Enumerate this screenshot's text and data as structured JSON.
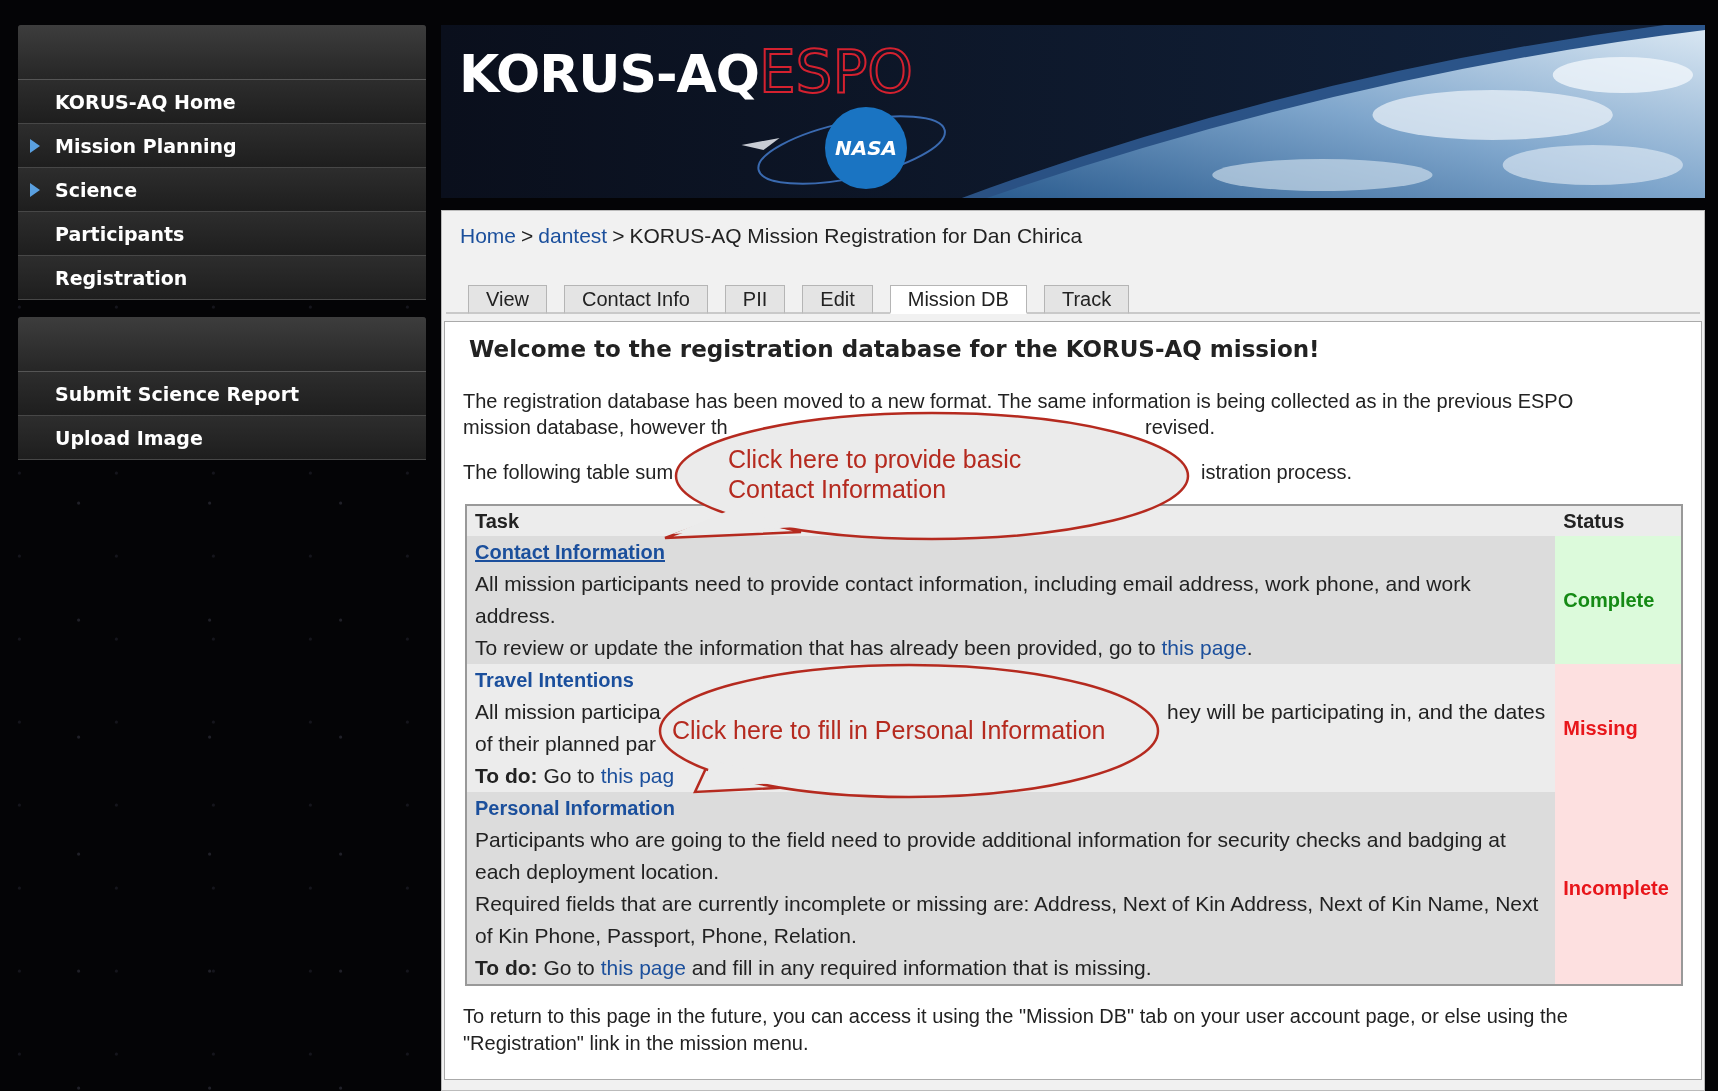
{
  "sidebar": {
    "menus": [
      {
        "items": [
          {
            "label": "KORUS-AQ Home",
            "expandable": false
          },
          {
            "label": "Mission Planning",
            "expandable": true
          },
          {
            "label": "Science",
            "expandable": true
          },
          {
            "label": "Participants",
            "expandable": false
          },
          {
            "label": "Registration",
            "expandable": false
          }
        ]
      },
      {
        "items": [
          {
            "label": "Submit Science Report",
            "expandable": false
          },
          {
            "label": "Upload Image",
            "expandable": false
          }
        ]
      }
    ]
  },
  "banner": {
    "title": "KORUS-AQ",
    "brand": "ESPO",
    "logo_text": "NASA"
  },
  "breadcrumb": [
    {
      "label": "Home",
      "kind": "link"
    },
    {
      "label": ">",
      "kind": "separator"
    },
    {
      "label": "dantest",
      "kind": "link"
    },
    {
      "label": ">",
      "kind": "separator"
    },
    {
      "label": "KORUS-AQ Mission Registration for Dan Chirica",
      "kind": "current"
    }
  ],
  "tabs": [
    {
      "label": "View",
      "selected": false
    },
    {
      "label": "Contact Info",
      "selected": false
    },
    {
      "label": "PII",
      "selected": false
    },
    {
      "label": "Edit",
      "selected": false
    },
    {
      "label": "Mission DB",
      "selected": true
    },
    {
      "label": "Track",
      "selected": false
    }
  ],
  "heading": "Welcome to the registration database for the KORUS-AQ mission!",
  "intro": [
    {
      "lines": [
        {
          "text": "The registration database has been moved to a new format. The same information is being collected as in the previous ESPO"
        },
        {
          "text": "mission database, however th",
          "after": "revised."
        }
      ]
    },
    {
      "lines": [
        {
          "text": "The following table sum",
          "after": "istration process."
        }
      ]
    }
  ],
  "table": {
    "columns": [
      "Task",
      "Status"
    ],
    "rows": [
      {
        "task": "Contact Information",
        "underlined": true,
        "paragraphs": [
          {
            "parts": [
              {
                "kind": "text",
                "text": "All mission participants need to provide contact information, including email address, work phone, and work address."
              }
            ]
          },
          {
            "parts": [
              {
                "kind": "text",
                "text": "To review or update the information that has already been provided, go to "
              },
              {
                "kind": "link",
                "text": "this page"
              },
              {
                "kind": "text",
                "text": "."
              }
            ]
          }
        ],
        "status": {
          "label": "Complete",
          "kind": "complete"
        }
      },
      {
        "task": "Travel Intentions",
        "underlined": false,
        "paragraphs": [
          {
            "parts": [
              {
                "kind": "text",
                "text": "All mission participa"
              }
            ],
            "after": "hey will be participating in, and the dates"
          },
          {
            "parts": [
              {
                "kind": "text",
                "text": "of their planned par"
              }
            ]
          },
          {
            "parts": [
              {
                "kind": "bold",
                "text": "To do:"
              },
              {
                "kind": "text",
                "text": " Go to "
              },
              {
                "kind": "link",
                "text": "this pag"
              }
            ]
          }
        ],
        "status": {
          "label": "Missing",
          "kind": "missing"
        }
      },
      {
        "task": "Personal Information",
        "underlined": false,
        "paragraphs": [
          {
            "parts": [
              {
                "kind": "text",
                "text": "Participants who are going to the field need to provide additional information for security checks and badging at each deployment location."
              }
            ]
          },
          {
            "parts": [
              {
                "kind": "text",
                "text": "Required fields that are currently incomplete or missing are: Address, Next of Kin Address, Next of Kin Name, Next of Kin Phone, Passport, Phone, Relation."
              }
            ]
          },
          {
            "parts": [
              {
                "kind": "bold",
                "text": "To do:"
              },
              {
                "kind": "text",
                "text": " Go to "
              },
              {
                "kind": "link",
                "text": "this page"
              },
              {
                "kind": "text",
                "text": " and fill in any required information that is missing."
              }
            ]
          }
        ],
        "status": {
          "label": "Incomplete",
          "kind": "incomplete"
        }
      }
    ]
  },
  "footer": "To return to this page in the future, you can access it using the \"Mission DB\" tab on your user account page, or else using the \"Registration\" link in the mission menu.",
  "callouts": [
    {
      "text": "Click here to provide basic Contact Information"
    },
    {
      "text": "Click here to fill in Personal Information"
    }
  ]
}
